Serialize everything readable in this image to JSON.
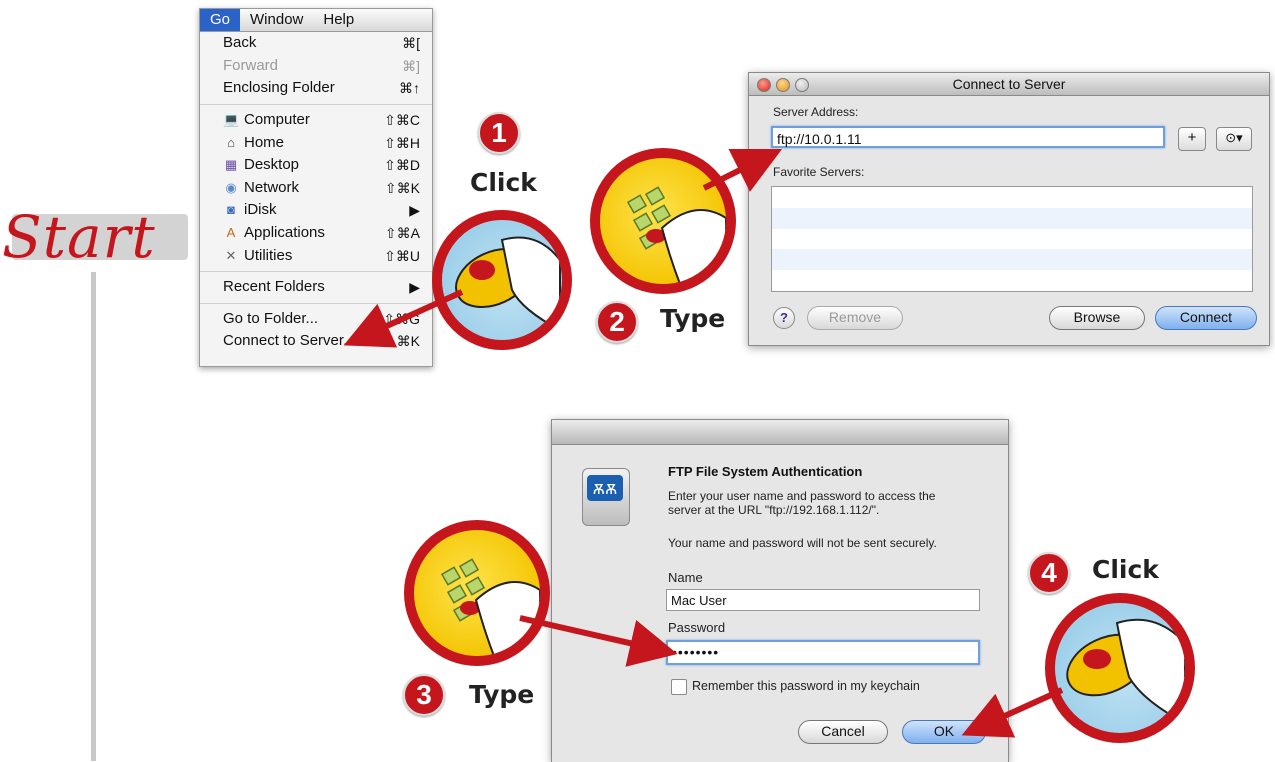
{
  "start": {
    "label": "Start"
  },
  "go_menu": {
    "menubar": [
      "Go",
      "Window",
      "Help"
    ],
    "items": [
      {
        "label": "Back",
        "shortcut": "⌘[",
        "icon": "",
        "disabled": false
      },
      {
        "label": "Forward",
        "shortcut": "⌘]",
        "icon": "",
        "disabled": true
      },
      {
        "label": "Enclosing Folder",
        "shortcut": "⌘↑",
        "icon": "",
        "disabled": false
      },
      {
        "label": "Computer",
        "shortcut": "⇧⌘C",
        "icon": "computer-icon",
        "disabled": false
      },
      {
        "label": "Home",
        "shortcut": "⇧⌘H",
        "icon": "home-icon",
        "disabled": false
      },
      {
        "label": "Desktop",
        "shortcut": "⇧⌘D",
        "icon": "desktop-icon",
        "disabled": false
      },
      {
        "label": "Network",
        "shortcut": "⇧⌘K",
        "icon": "network-icon",
        "disabled": false
      },
      {
        "label": "iDisk",
        "shortcut": "▶",
        "icon": "idisk-icon",
        "disabled": false
      },
      {
        "label": "Applications",
        "shortcut": "⇧⌘A",
        "icon": "applications-icon",
        "disabled": false
      },
      {
        "label": "Utilities",
        "shortcut": "⇧⌘U",
        "icon": "utilities-icon",
        "disabled": false
      },
      {
        "label": "Recent Folders",
        "shortcut": "▶",
        "icon": "",
        "disabled": false
      },
      {
        "label": "Go to Folder...",
        "shortcut": "⇧⌘G",
        "icon": "",
        "disabled": false
      },
      {
        "label": "Connect to Server...",
        "shortcut": "⌘K",
        "icon": "",
        "disabled": false
      }
    ]
  },
  "connect_to_server": {
    "title": "Connect to Server",
    "server_address_label": "Server Address:",
    "server_address_value": "ftp://10.0.1.11",
    "add_button": "+",
    "recent_button": "⊙▾",
    "favorite_servers_label": "Favorite Servers:",
    "help_button": "?",
    "remove_button": "Remove",
    "browse_button": "Browse",
    "connect_button": "Connect"
  },
  "ftp_auth": {
    "heading": "FTP File System Authentication",
    "message": "Enter your user name and password to access the server at the URL \"ftp://192.168.1.112/\".",
    "warning": "Your name and password will not be sent securely.",
    "name_label": "Name",
    "name_value": "Mac User",
    "password_label": "Password",
    "password_value": "••••••••",
    "remember_label": "Remember this password in my keychain",
    "cancel_button": "Cancel",
    "ok_button": "OK"
  },
  "steps": [
    {
      "number": "1",
      "action": "Click"
    },
    {
      "number": "2",
      "action": "Type"
    },
    {
      "number": "3",
      "action": "Type"
    },
    {
      "number": "4",
      "action": "Click"
    }
  ],
  "colors": {
    "accent_red": "#c4161c",
    "menu_highlight": "#2a62c8",
    "focus_blue": "#6ea0e0"
  }
}
